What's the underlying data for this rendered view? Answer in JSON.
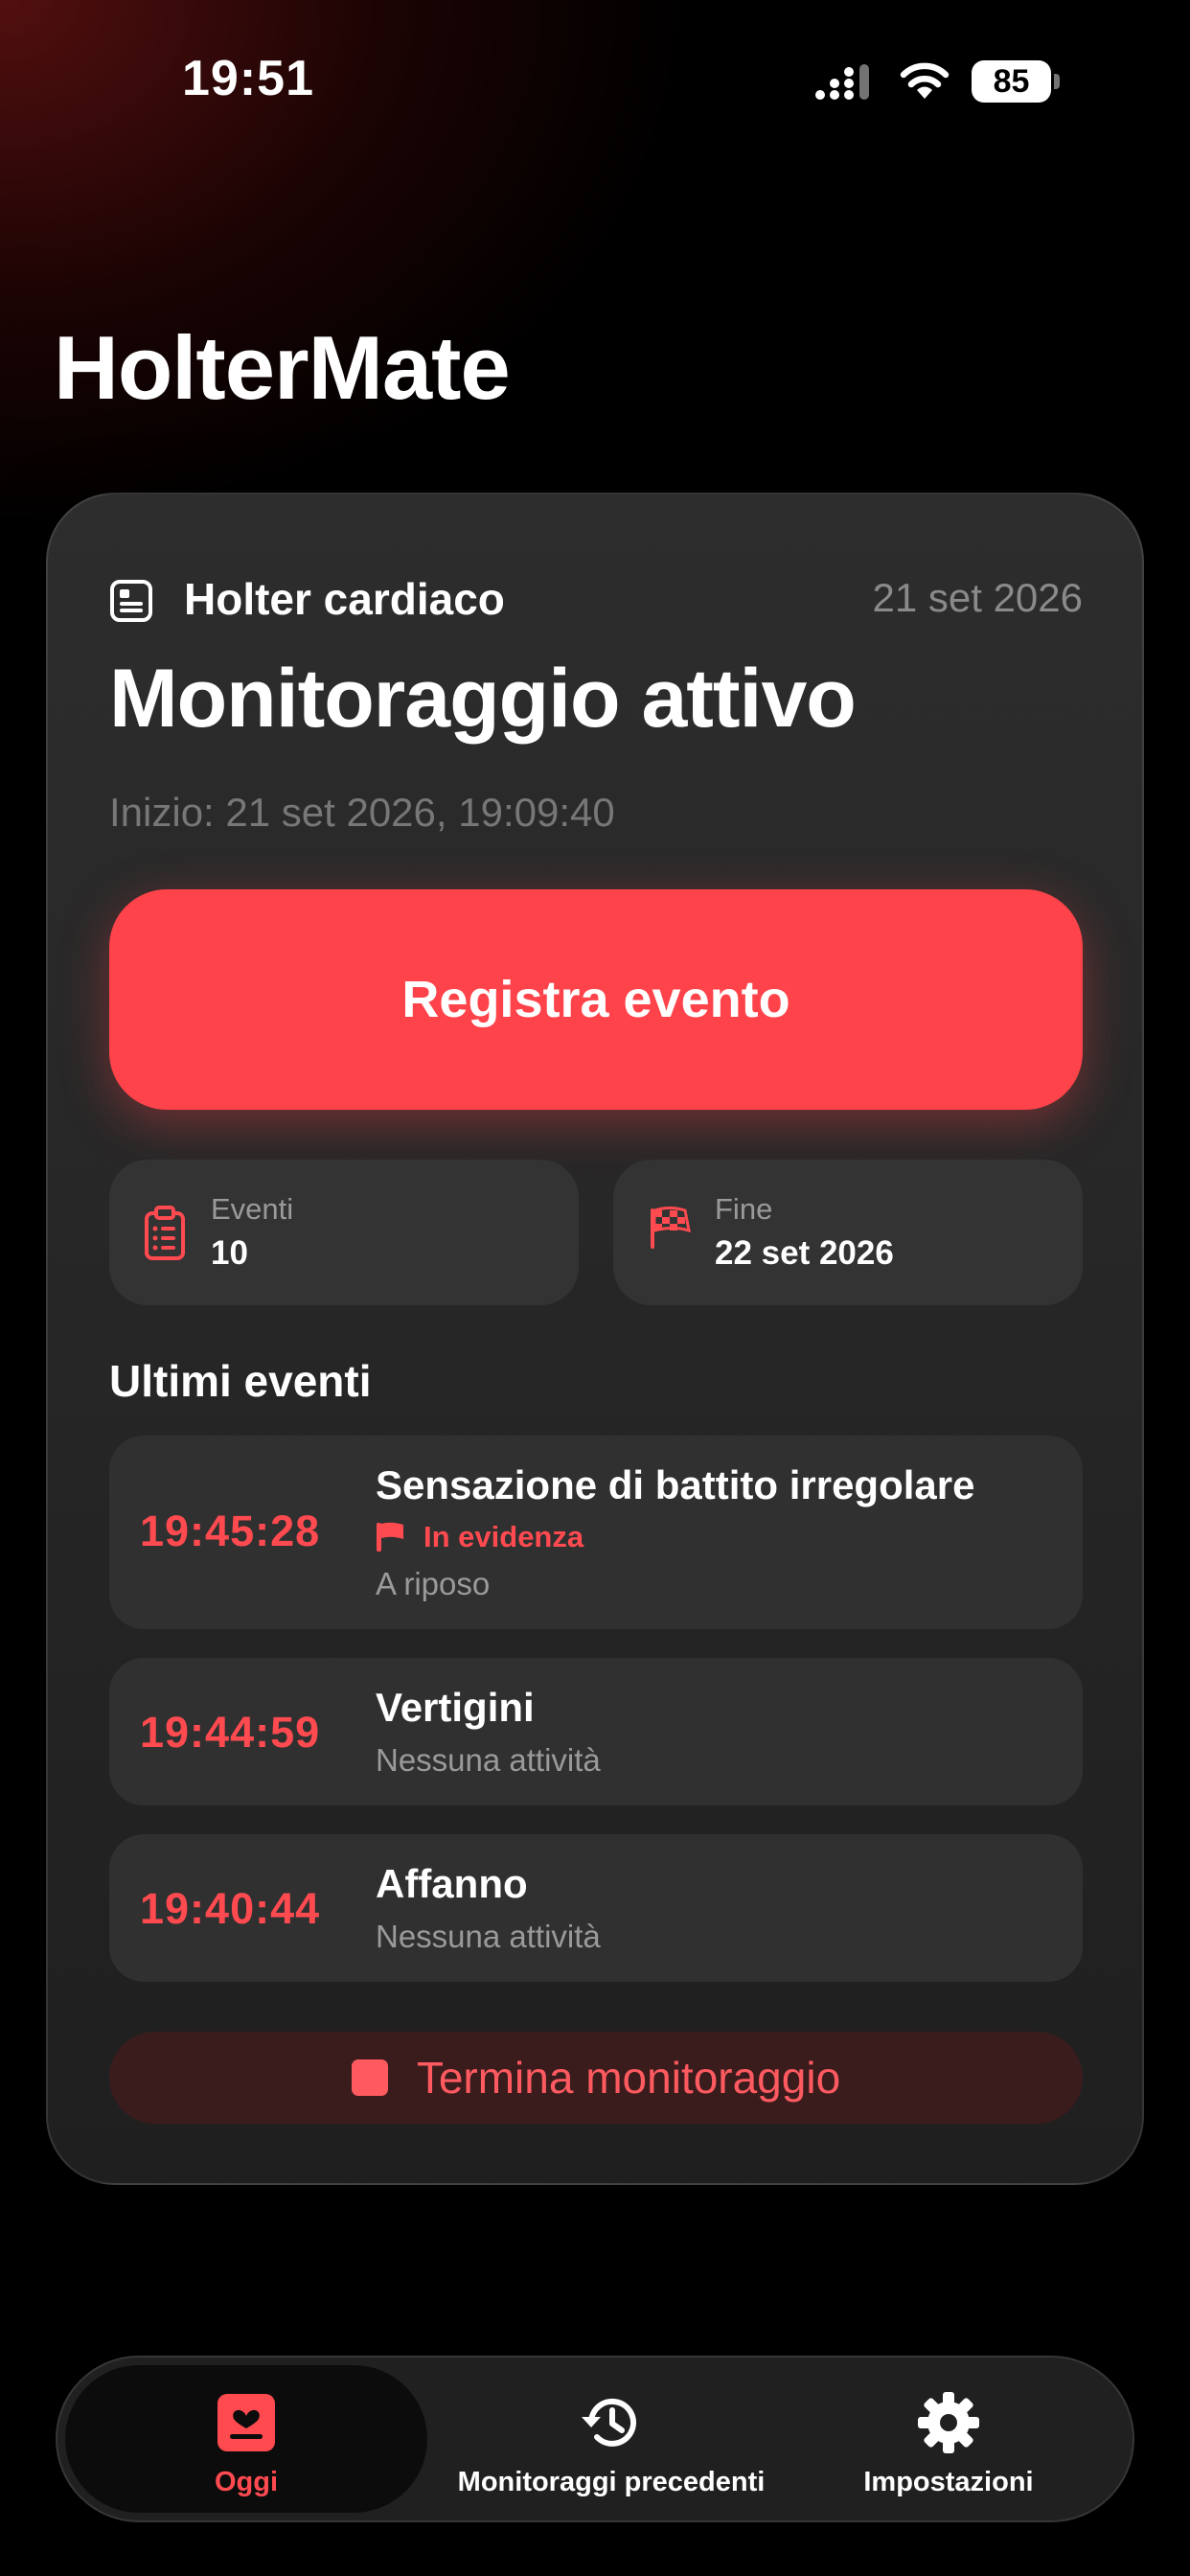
{
  "status_bar": {
    "time": "19:51",
    "battery": "85",
    "icons": [
      "signal-icon",
      "wifi-icon",
      "battery-icon"
    ]
  },
  "app": {
    "title": "HolterMate"
  },
  "monitoring": {
    "kind": "Holter cardiaco",
    "date": "21 set 2026",
    "status": "Monitoraggio attivo",
    "start": "Inizio: 21 set 2026, 19:09:40",
    "record_button": "Registra evento",
    "stats": {
      "events_label": "Eventi",
      "events_value": "10",
      "end_label": "Fine",
      "end_value": "22 set 2026"
    },
    "recent_title": "Ultimi eventi",
    "events": [
      {
        "time": "19:45:28",
        "title": "Sensazione di battito irregolare",
        "flag": "In evidenza",
        "activity": "A riposo"
      },
      {
        "time": "19:44:59",
        "title": "Vertigini",
        "activity": "Nessuna attività"
      },
      {
        "time": "19:40:44",
        "title": "Affanno",
        "activity": "Nessuna attività"
      }
    ],
    "end_button": "Termina monitoraggio"
  },
  "tab_bar": {
    "tabs": [
      {
        "label": "Oggi",
        "icon": "today-icon",
        "active": true
      },
      {
        "label": "Monitoraggi precedenti",
        "icon": "history-icon",
        "active": false
      },
      {
        "label": "Impostazioni",
        "icon": "gear-icon",
        "active": false
      }
    ]
  },
  "colors": {
    "accent": "#ff434a",
    "background": "#000000",
    "card": "#262626",
    "muted_text": "#9a9a9a"
  }
}
